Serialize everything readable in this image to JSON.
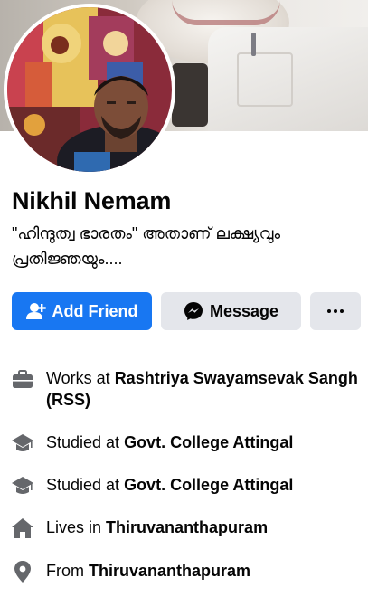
{
  "profile": {
    "name": "Nikhil Nemam",
    "bio": "\"ഹിന്ദുത്വ ഭാരതം\" അതാണ് ലക്ഷ്യവും പ്രതിജ്ഞയും...."
  },
  "actions": {
    "add_friend": "Add Friend",
    "message": "Message"
  },
  "details": [
    {
      "prefix": "Works at ",
      "value": "Rashtriya Swayamsevak Sangh (RSS)",
      "icon": "briefcase-icon"
    },
    {
      "prefix": "Studied at ",
      "value": "Govt. College Attingal",
      "icon": "graduation-cap-icon"
    },
    {
      "prefix": "Studied at ",
      "value": "Govt. College Attingal",
      "icon": "graduation-cap-icon"
    },
    {
      "prefix": "Lives in ",
      "value": "Thiruvananthapuram",
      "icon": "home-icon"
    },
    {
      "prefix": "From ",
      "value": "Thiruvananthapuram",
      "icon": "location-pin-icon"
    }
  ],
  "colors": {
    "primary": "#1877f2",
    "secondary_button": "#e4e6eb",
    "icon_gray": "#65676b",
    "text": "#050505"
  }
}
